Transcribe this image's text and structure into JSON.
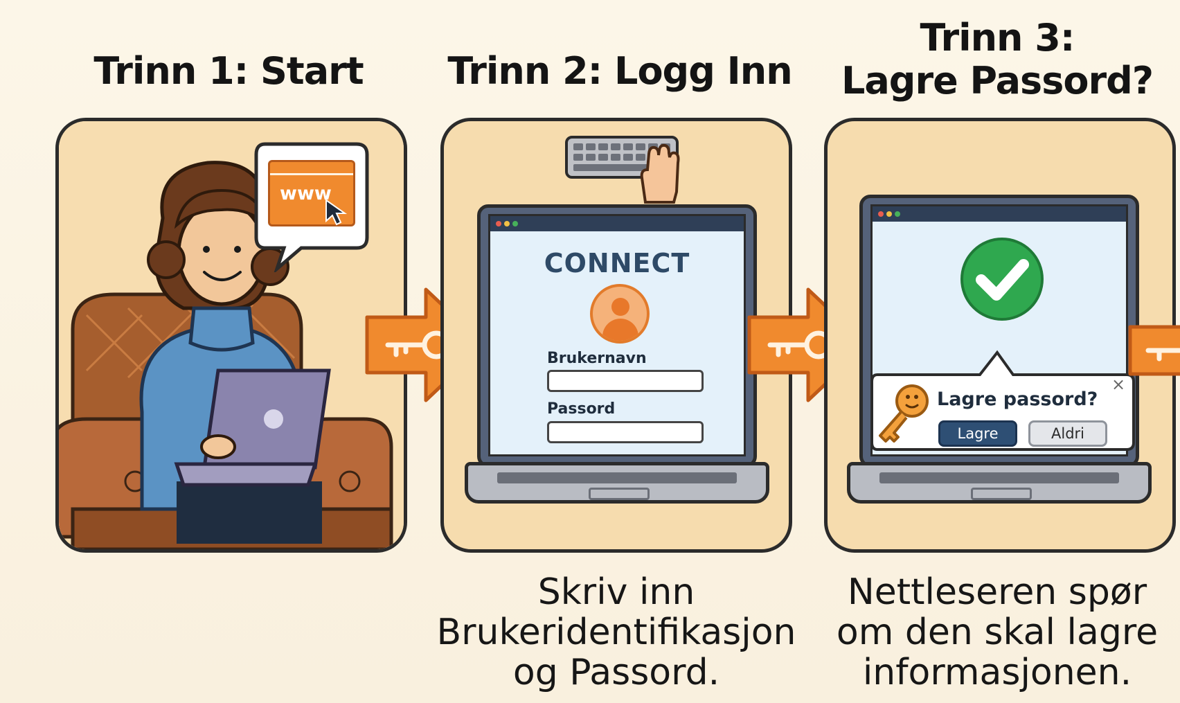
{
  "steps": [
    {
      "title_lines": [
        "Trinn 1: Start"
      ],
      "bubble_text": "www",
      "caption_lines": []
    },
    {
      "title_lines": [
        "Trinn 2: Logg Inn"
      ],
      "screen_heading": "CONNECT",
      "username_label": "Brukernavn",
      "password_label": "Passord",
      "caption_lines": [
        "Skriv inn",
        "Brukeridentifikasjon",
        "og Passord."
      ]
    },
    {
      "title_lines": [
        "Trinn 3:",
        "Lagre Passord?"
      ],
      "dialog_title": "Lagre passord?",
      "dialog_close": "×",
      "save_button": "Lagre",
      "never_button": "Aldri",
      "caption_lines": [
        "Nettleseren spør",
        "om den skal lagre",
        "informasjonen."
      ]
    }
  ],
  "colors": {
    "accent_orange": "#f08a2e",
    "panel_bg": "#f6dcae",
    "success_green": "#2fa84f",
    "primary_button": "#2e4f74"
  },
  "icons": [
    "key-icon",
    "keyboard-icon",
    "hand-icon",
    "cursor-icon",
    "user-icon",
    "checkmark-icon",
    "close-icon"
  ]
}
